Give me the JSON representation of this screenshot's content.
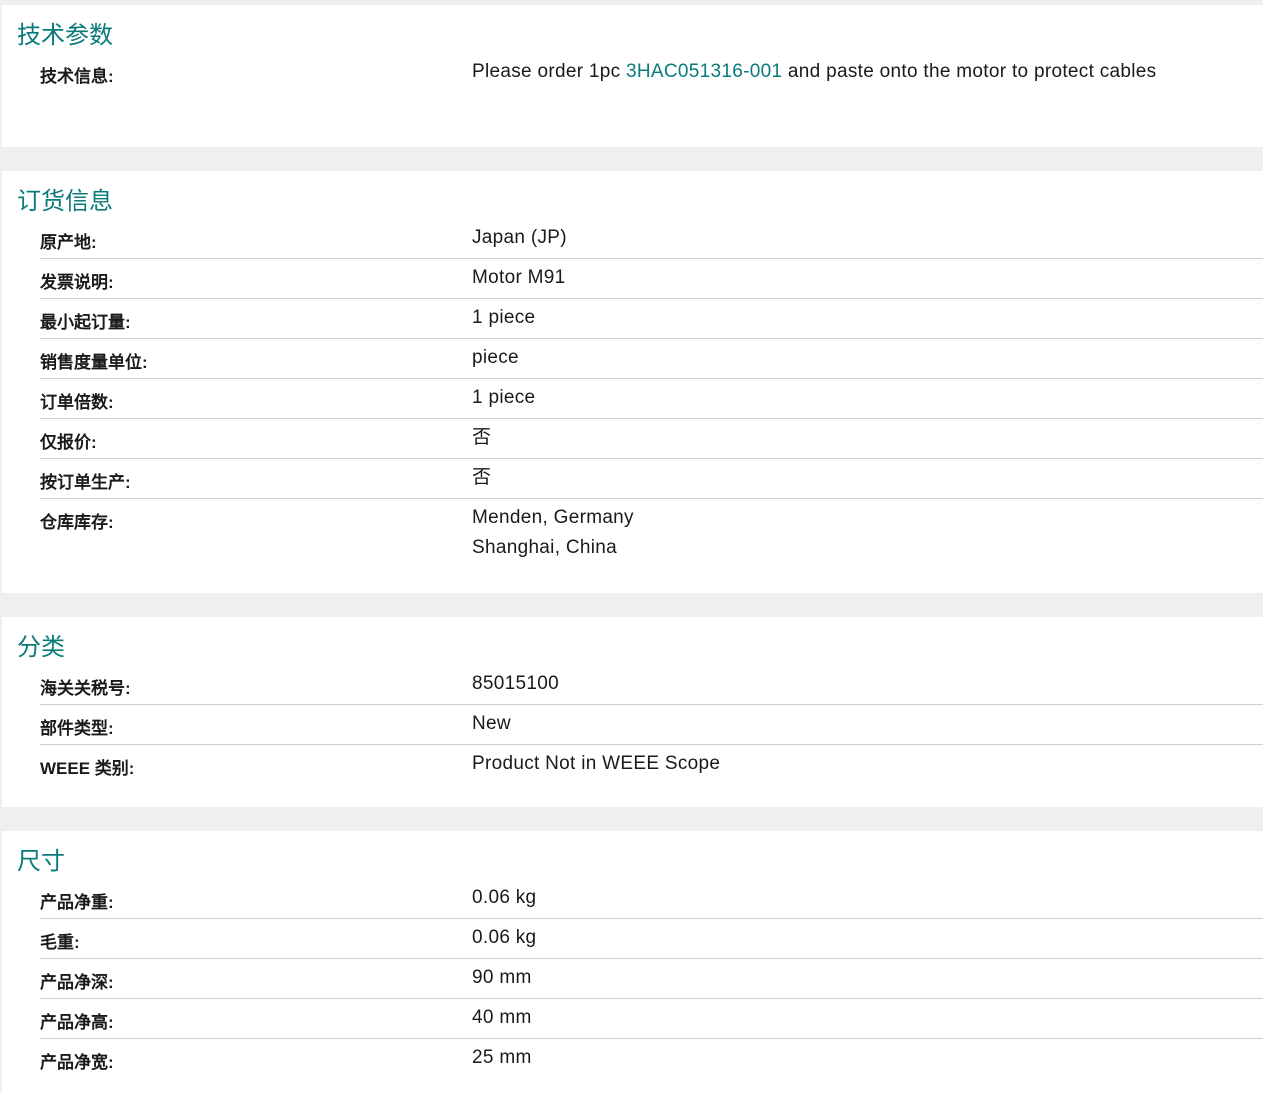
{
  "sections": [
    {
      "title": "技术参数",
      "rows": [
        {
          "label": "技术信息:",
          "value_prefix": "Please order 1pc ",
          "value_link": "3HAC051316-001",
          "value_suffix": " and  paste onto the motor to protect cables"
        }
      ]
    },
    {
      "title": "订货信息",
      "rows": [
        {
          "label": "原产地:",
          "value": "Japan (JP)"
        },
        {
          "label": "发票说明:",
          "value": "Motor M91"
        },
        {
          "label": "最小起订量:",
          "value": "1 piece"
        },
        {
          "label": "销售度量单位:",
          "value": "piece"
        },
        {
          "label": "订单倍数:",
          "value": "1 piece"
        },
        {
          "label": "仅报价:",
          "value": "否"
        },
        {
          "label": "按订单生产:",
          "value": "否"
        },
        {
          "label": "仓库库存:",
          "value_line1": "Menden, Germany",
          "value_line2": "Shanghai, China"
        }
      ]
    },
    {
      "title": "分类",
      "rows": [
        {
          "label": "海关关税号:",
          "value": "85015100"
        },
        {
          "label": "部件类型:",
          "value": "New"
        },
        {
          "label": "WEEE 类别:",
          "value": "Product Not in WEEE Scope"
        }
      ]
    },
    {
      "title": "尺寸",
      "rows": [
        {
          "label": "产品净重:",
          "value": "0.06 kg"
        },
        {
          "label": "毛重:",
          "value": "0.06 kg"
        },
        {
          "label": "产品净深:",
          "value": "90 mm"
        },
        {
          "label": "产品净高:",
          "value": "40 mm"
        },
        {
          "label": "产品净宽:",
          "value": "25 mm"
        }
      ]
    }
  ],
  "colors": {
    "accent": "#0b7a7a",
    "divider": "#cfcfcf",
    "background": "#efefef"
  }
}
